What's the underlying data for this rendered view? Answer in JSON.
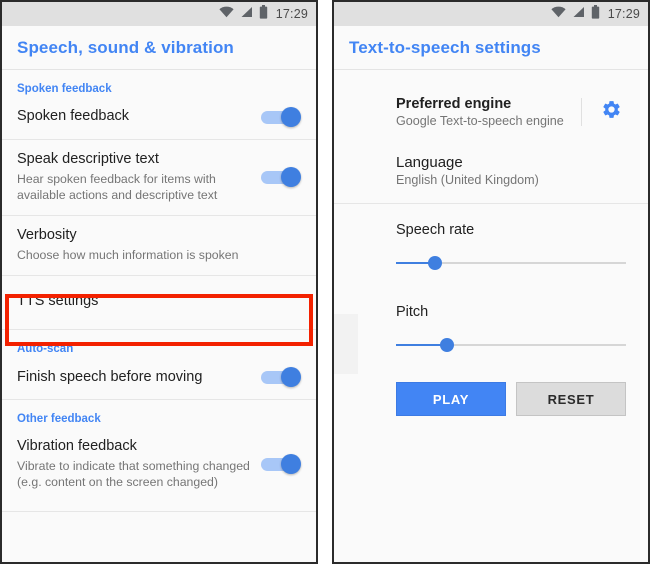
{
  "status_bar": {
    "time": "17:29",
    "icons": [
      "wifi-icon",
      "signal-icon",
      "battery-icon"
    ]
  },
  "colors": {
    "accent": "#4285f4",
    "toggle_thumb": "#3f7fe0",
    "toggle_track": "#a8c7f7",
    "highlight": "#f32100",
    "status_bar_bg": "#e0e0e0",
    "page_bg": "#fafafa"
  },
  "left_screen": {
    "title": "Speech, sound & vibration",
    "sections": [
      {
        "heading": "Spoken feedback",
        "rows": [
          {
            "title": "Spoken feedback",
            "subtitle": "",
            "toggle": "on"
          },
          {
            "title": "Speak descriptive text",
            "subtitle": "Hear spoken feedback for items with available actions and descriptive text",
            "toggle": "on"
          },
          {
            "title": "Verbosity",
            "subtitle": "Choose how much information is spoken",
            "toggle": "none"
          },
          {
            "title": "TTS settings",
            "subtitle": "",
            "toggle": "none",
            "highlighted": true
          }
        ]
      },
      {
        "heading": "Auto-scan",
        "rows": [
          {
            "title": "Finish speech before moving",
            "subtitle": "",
            "toggle": "on"
          }
        ]
      },
      {
        "heading": "Other feedback",
        "rows": [
          {
            "title": "Vibration feedback",
            "subtitle": "Vibrate to indicate that something changed (e.g. content on the screen changed)",
            "toggle": "on"
          }
        ]
      }
    ]
  },
  "right_screen": {
    "title": "Text-to-speech settings",
    "preferred_engine": {
      "title": "Preferred engine",
      "subtitle": "Google Text-to-speech engine",
      "settings_icon": "gear-icon"
    },
    "language": {
      "title": "Language",
      "subtitle": "English (United Kingdom)"
    },
    "speech_rate": {
      "label": "Speech rate",
      "value_percent": 17
    },
    "pitch": {
      "label": "Pitch",
      "value_percent": 22
    },
    "buttons": {
      "play": "PLAY",
      "reset": "RESET"
    }
  }
}
